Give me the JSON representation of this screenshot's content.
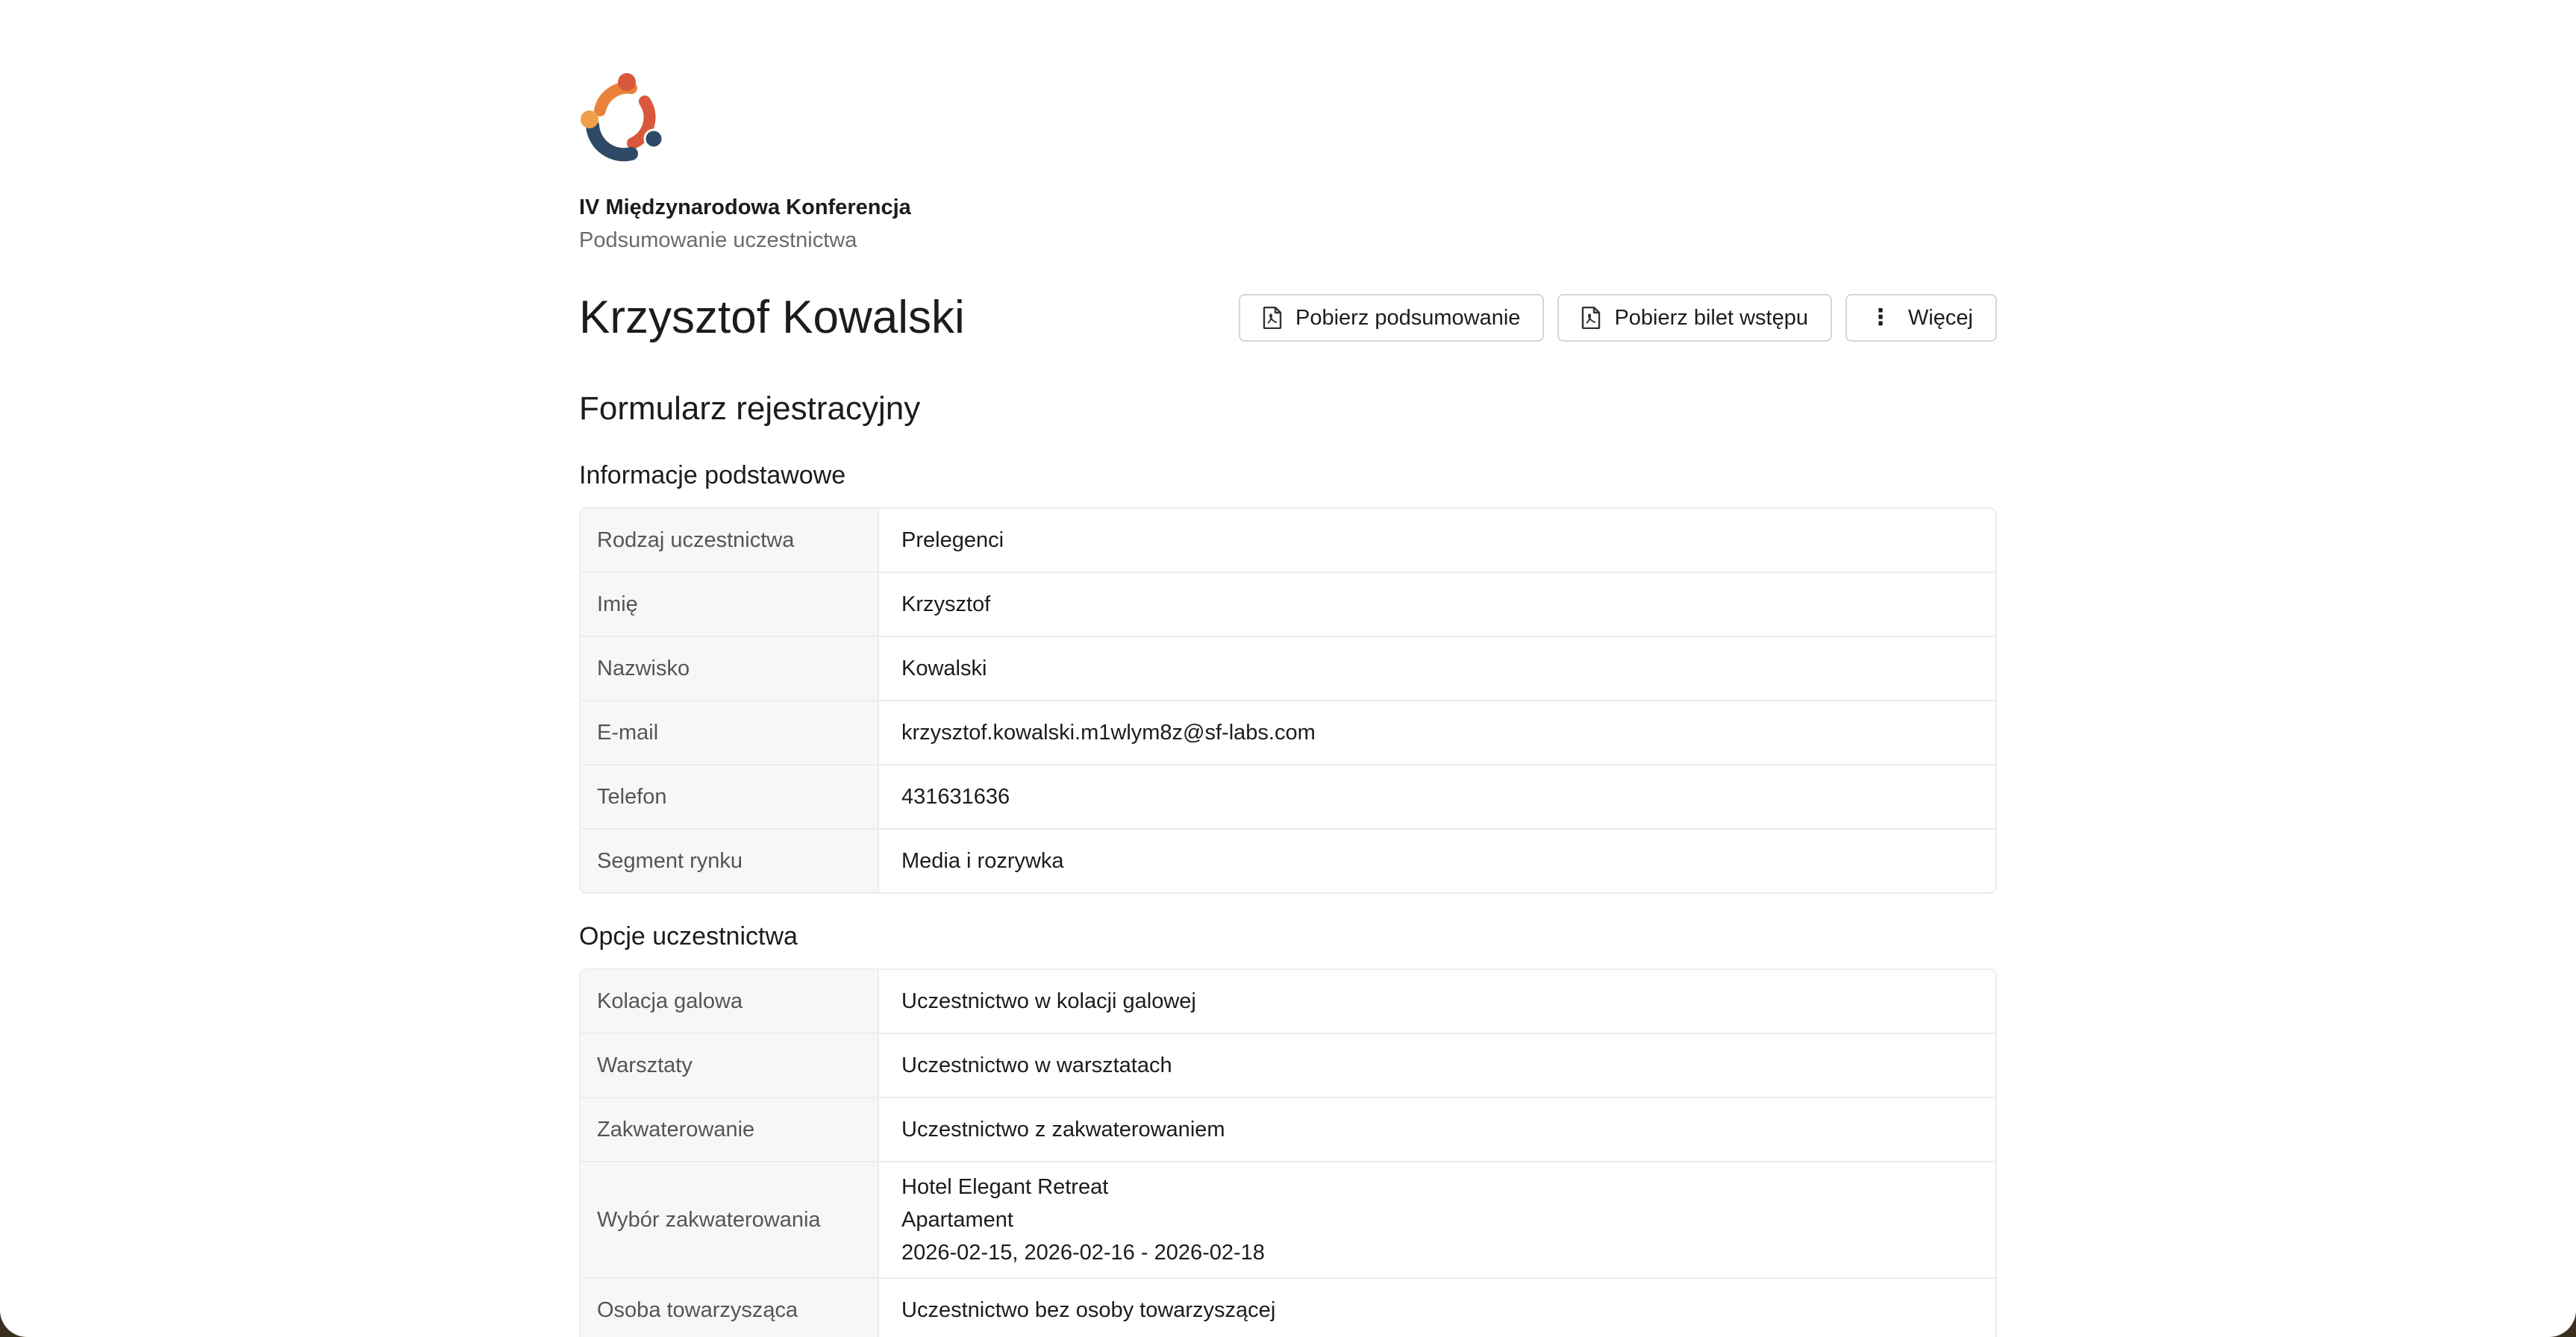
{
  "event": {
    "title": "IV Międzynarodowa Konferencja",
    "subtitle": "Podsumowanie uczestnictwa"
  },
  "participant": {
    "name": "Krzysztof Kowalski"
  },
  "actions": {
    "download_summary": "Pobierz podsumowanie",
    "download_ticket": "Pobierz bilet wstępu",
    "more": "Więcej"
  },
  "form": {
    "title": "Formularz rejestracyjny",
    "basic": {
      "title": "Informacje podstawowe",
      "rows": [
        {
          "label": "Rodzaj uczestnictwa",
          "value": "Prelegenci"
        },
        {
          "label": "Imię",
          "value": "Krzysztof"
        },
        {
          "label": "Nazwisko",
          "value": "Kowalski"
        },
        {
          "label": "E-mail",
          "value": "krzysztof.kowalski.m1wlym8z@sf-labs.com"
        },
        {
          "label": "Telefon",
          "value": "431631636"
        },
        {
          "label": "Segment rynku",
          "value": "Media i rozrywka"
        }
      ]
    },
    "options": {
      "title": "Opcje uczestnictwa",
      "rows": [
        {
          "label": "Kolacja galowa",
          "value": "Uczestnictwo w kolacji galowej"
        },
        {
          "label": "Warsztaty",
          "value": "Uczestnictwo w warsztatach"
        },
        {
          "label": "Zakwaterowanie",
          "value": "Uczestnictwo z zakwaterowaniem"
        },
        {
          "label": "Wybór zakwaterowania",
          "lines": [
            "Hotel Elegant Retreat",
            "Apartament",
            "2026-02-15, 2026-02-16 - 2026-02-18"
          ]
        },
        {
          "label": "Osoba towarzysząca",
          "value": "Uczestnictwo bez osoby towarzyszącej"
        }
      ]
    }
  },
  "colors": {
    "logo_orange": "#e8823a",
    "logo_red": "#d9573a",
    "logo_navy": "#2f4a66"
  }
}
